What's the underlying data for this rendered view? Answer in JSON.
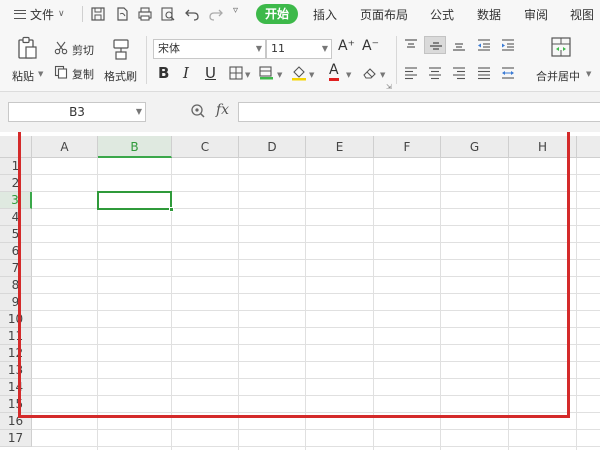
{
  "menubar": {
    "file_label": "文件",
    "tabs": [
      "开始",
      "插入",
      "页面布局",
      "公式",
      "数据",
      "审阅",
      "视图"
    ],
    "active_tab": "开始"
  },
  "ribbon": {
    "paste_label": "粘贴",
    "cut_label": "剪切",
    "copy_label": "复制",
    "format_painter_label": "格式刷",
    "font_name": "宋体",
    "font_size": "11",
    "bold_label": "B",
    "italic_label": "I",
    "underline_label": "U",
    "font_color_label": "A",
    "grow_font_label": "A⁺",
    "shrink_font_label": "A⁻",
    "merge_center_label": "合并居中"
  },
  "formula_bar": {
    "name_box": "B3",
    "fx_label": "fx",
    "formula_value": ""
  },
  "sheet": {
    "columns": [
      "A",
      "B",
      "C",
      "D",
      "E",
      "F",
      "G",
      "H"
    ],
    "rows": [
      "1",
      "2",
      "3",
      "4",
      "5",
      "6",
      "7",
      "8",
      "9",
      "10",
      "11",
      "12",
      "13",
      "14",
      "15",
      "16",
      "17"
    ],
    "active_column": "B",
    "active_row": "3"
  },
  "colors": {
    "accent_green": "#3db94a",
    "selection_green": "#2f9a3a",
    "highlight_red": "#d42a2a"
  }
}
